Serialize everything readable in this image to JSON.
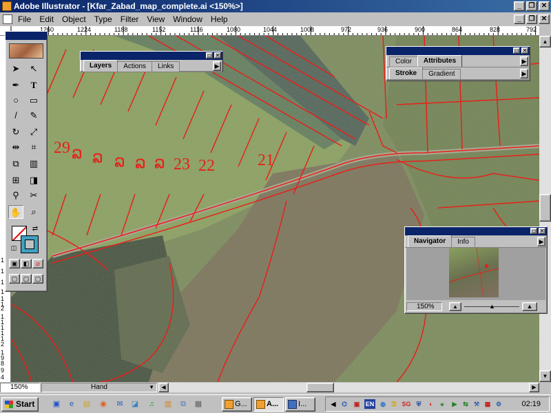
{
  "window": {
    "title": "Adobe Illustrator - [Kfar_Zabad_map_complete.ai <150%>]",
    "buttons": {
      "minimize": "_",
      "restore": "❐",
      "close": "✕"
    }
  },
  "menu": {
    "items": [
      "File",
      "Edit",
      "Object",
      "Type",
      "Filter",
      "View",
      "Window",
      "Help"
    ]
  },
  "ruler": {
    "horizontal": [
      "1260",
      "1224",
      "1188",
      "1152",
      "1116",
      "1080",
      "1044",
      "1008",
      "972",
      "936",
      "900",
      "864",
      "828",
      "792"
    ],
    "vertical": [
      "1",
      "1",
      "1",
      "1",
      "1",
      "1",
      "2",
      "1",
      "1",
      "1",
      "1",
      "1",
      "2",
      "1",
      "9",
      "8",
      "9",
      "4"
    ]
  },
  "map": {
    "labels": [
      "29",
      "ລ",
      "ລ",
      "ລ",
      "ລ",
      "ລ",
      "23",
      "22",
      "21"
    ],
    "colors": {
      "line": "#e8201a",
      "background": "#6b7a52"
    }
  },
  "layers_panel": {
    "tabs": [
      "Layers",
      "Actions",
      "Links"
    ],
    "active_tab": "Layers"
  },
  "color_panel": {
    "tabs_row1": [
      "Color",
      "Attributes"
    ],
    "active_row1": "Attributes",
    "tabs_row2": [
      "Stroke",
      "Gradient"
    ],
    "active_row2": "Stroke"
  },
  "navigator_panel": {
    "tabs": [
      "Navigator",
      "Info"
    ],
    "active_tab": "Navigator",
    "zoom": "150%"
  },
  "statusbar": {
    "zoom": "150%",
    "tool": "Hand"
  },
  "taskbar": {
    "start_label": "Start",
    "tasks": [
      "G...",
      "A...",
      "I..."
    ],
    "language": "EN",
    "clock": "02:19"
  }
}
